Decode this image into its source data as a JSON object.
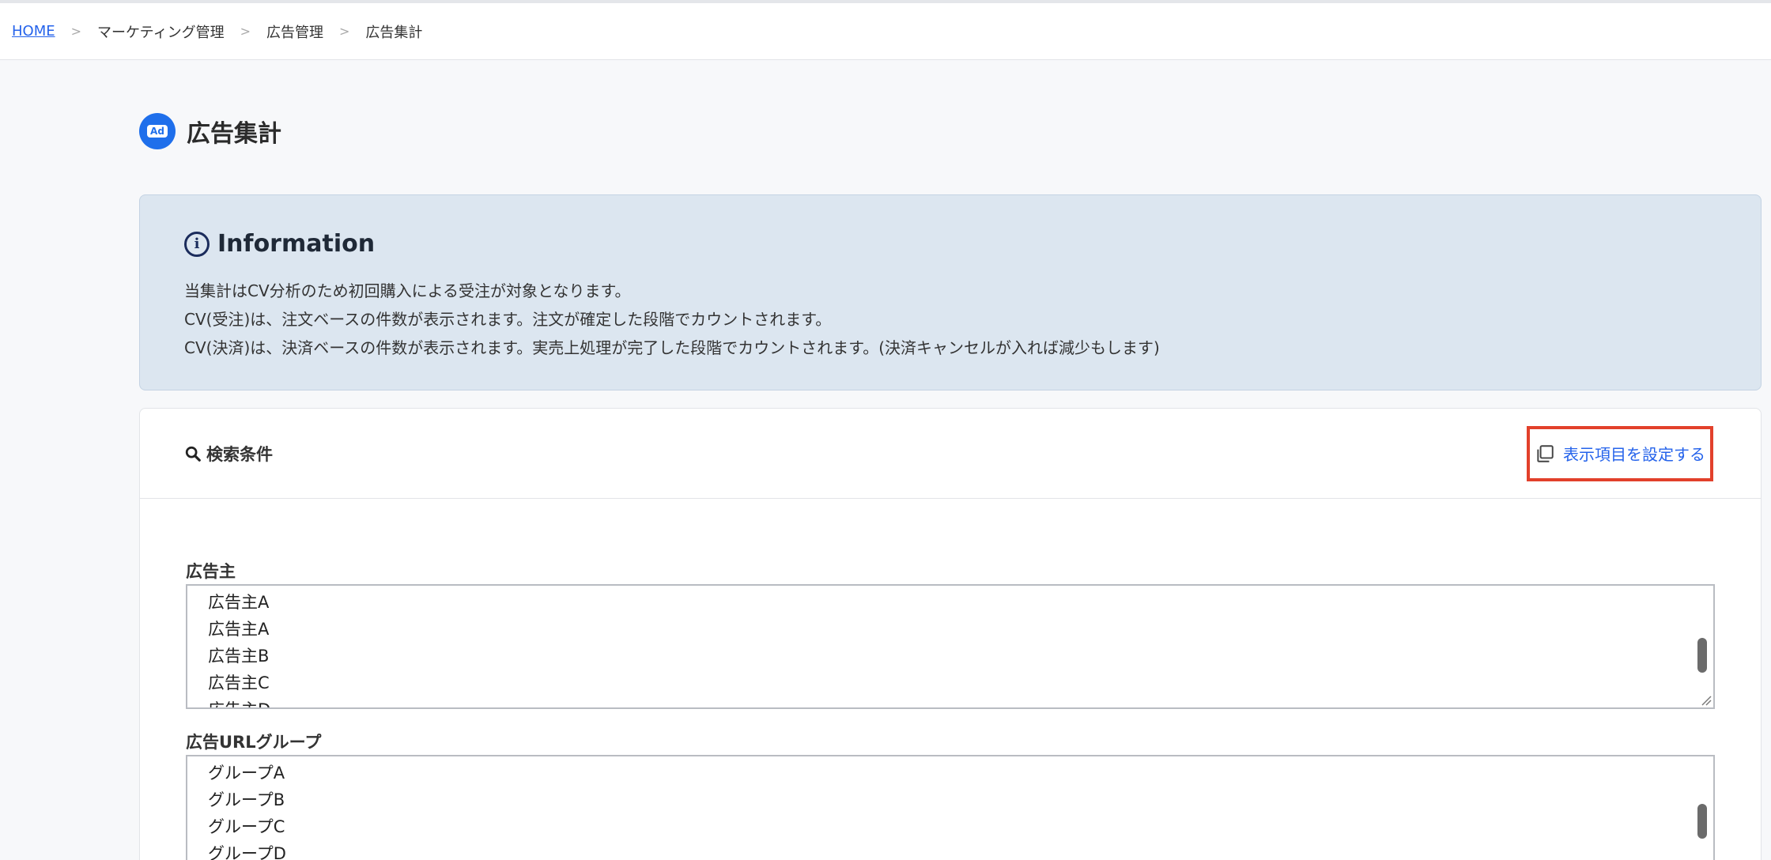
{
  "breadcrumb": {
    "home": "HOME",
    "items": [
      "マーケティング管理",
      "広告管理",
      "広告集計"
    ],
    "separator": ">"
  },
  "page": {
    "title": "広告集計",
    "icon_label": "Ad"
  },
  "info": {
    "title": "Information",
    "lines": [
      "当集計はCV分析のため初回購入による受注が対象となります。",
      "CV(受注)は、注文ベースの件数が表示されます。注文が確定した段階でカウントされます。",
      "CV(決済)は、決済ベースの件数が表示されます。実売上処理が完了した段階でカウントされます。(決済キャンセルが入れば減少もします)"
    ]
  },
  "search": {
    "title": "検索条件",
    "settings_label": "表示項目を設定する"
  },
  "advertiser": {
    "label": "広告主",
    "options": [
      "広告主A",
      "広告主A",
      "広告主B",
      "広告主C",
      "広告主D"
    ]
  },
  "url_group": {
    "label": "広告URLグループ",
    "options": [
      "グループA",
      "グループB",
      "グループC",
      "グループD"
    ]
  },
  "colors": {
    "accent": "#2563eb",
    "highlight_border": "#e2402b",
    "info_bg": "#dce6f0"
  }
}
